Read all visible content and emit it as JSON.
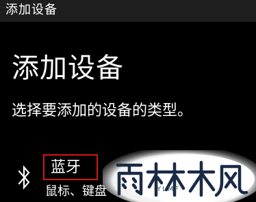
{
  "window": {
    "title": "添加设备"
  },
  "dialog": {
    "heading": "添加设备",
    "instruction": "选择要添加的设备的类型。"
  },
  "device_options": [
    {
      "icon": "bluetooth-icon",
      "label": "蓝牙",
      "description": "鼠标、键盘"
    }
  ],
  "watermark": {
    "brand": "雨林木风",
    "brand_latin": "YLMF"
  },
  "colors": {
    "background": "#000000",
    "titlebar": "#1e1e1e",
    "text": "#ffffff",
    "highlight_border": "#d01818"
  }
}
